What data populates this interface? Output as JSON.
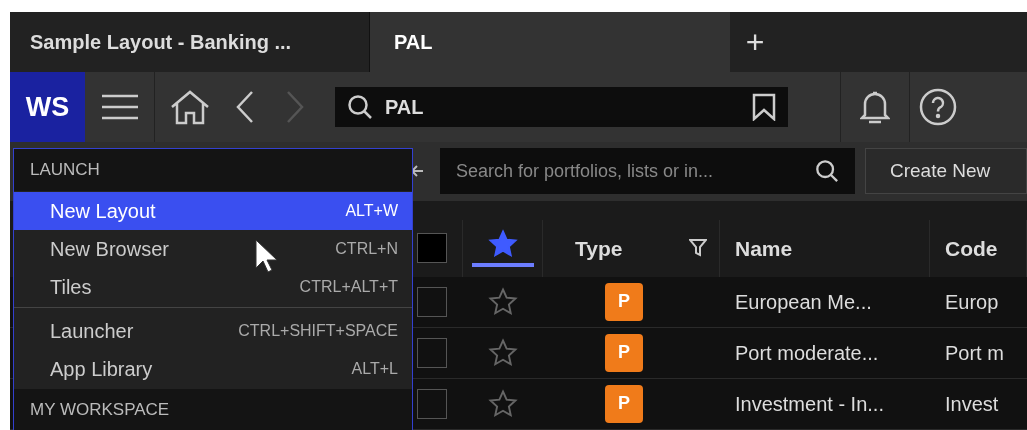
{
  "tabs": [
    {
      "label": "Sample Layout - Banking ...",
      "selected": false
    },
    {
      "label": "PAL",
      "selected": true
    }
  ],
  "new_tab_button": "+",
  "toolbar": {
    "logo": "WS",
    "search": {
      "value": "PAL"
    }
  },
  "subbar": {
    "search": {
      "placeholder": "Search for portfolios, lists or in..."
    },
    "create_button": "Create New"
  },
  "table": {
    "columns": [
      {
        "kind": "check",
        "checked": false
      },
      {
        "kind": "star",
        "selected": true
      },
      {
        "kind": "text",
        "label": "Type",
        "filter": true
      },
      {
        "kind": "text",
        "label": "Name"
      },
      {
        "kind": "text",
        "label": "Code"
      }
    ],
    "rows": [
      {
        "checked": false,
        "starred": false,
        "type": "P",
        "name": "European Me...",
        "code": "Europ"
      },
      {
        "checked": false,
        "starred": false,
        "type": "P",
        "name": "Port moderate...",
        "code": "Port m"
      },
      {
        "checked": false,
        "starred": false,
        "type": "P",
        "name": "Investment - In...",
        "code": "Invest"
      }
    ]
  },
  "menu": {
    "sections": [
      {
        "title": "LAUNCH",
        "groups": [
          {
            "items": [
              {
                "label": "New Layout",
                "shortcut": "ALT+W",
                "selected": true
              },
              {
                "label": "New Browser",
                "shortcut": "CTRL+N",
                "selected": false
              },
              {
                "label": "Tiles",
                "shortcut": "CTRL+ALT+T",
                "selected": false
              }
            ]
          },
          {
            "items": [
              {
                "label": "Launcher",
                "shortcut": "CTRL+SHIFT+SPACE",
                "selected": false
              },
              {
                "label": "App Library",
                "shortcut": "ALT+L",
                "selected": false
              }
            ]
          }
        ]
      },
      {
        "title": "MY WORKSPACE"
      }
    ]
  }
}
